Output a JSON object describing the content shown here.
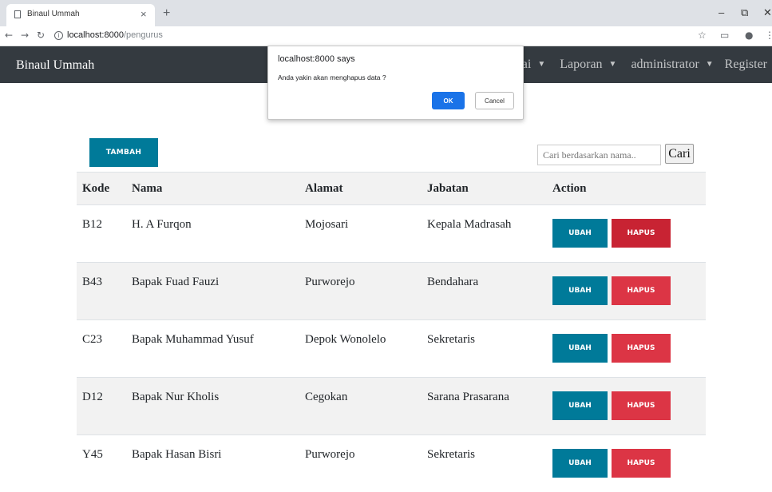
{
  "browser": {
    "tab_title": "Binaul Ummah",
    "tab_close": "×",
    "new_tab": "+",
    "url_host": "localhost:8000",
    "url_path": "/pengurus",
    "window_controls": [
      "–",
      "⧉",
      "✕"
    ]
  },
  "navbar": {
    "brand": "Binaul Ummah",
    "links": [
      "Nilai",
      "Laporan",
      "administrator",
      "Register"
    ]
  },
  "dialog": {
    "title": "localhost:8000 says",
    "message": "Anda yakin akan menghapus data ?",
    "ok_label": "OK",
    "cancel_label": "Cancel"
  },
  "toolbar": {
    "add_label": "TAMBAH",
    "search_placeholder": "Cari berdasarkan nama..",
    "search_button": "Cari"
  },
  "table": {
    "headers": [
      "Kode",
      "Nama",
      "Alamat",
      "Jabatan",
      "Action"
    ],
    "rows": [
      {
        "kode": "B12",
        "nama": "H. A Furqon",
        "alamat": "Mojosari",
        "jabatan": "Kepala Madrasah"
      },
      {
        "kode": "B43",
        "nama": "Bapak Fuad Fauzi",
        "alamat": "Purworejo",
        "jabatan": "Bendahara"
      },
      {
        "kode": "C23",
        "nama": "Bapak Muhammad Yusuf",
        "alamat": "Depok Wonolelo",
        "jabatan": "Sekretaris"
      },
      {
        "kode": "D12",
        "nama": "Bapak Nur Kholis",
        "alamat": "Cegokan",
        "jabatan": "Sarana Prasarana"
      },
      {
        "kode": "Y45",
        "nama": "Bapak Hasan Bisri",
        "alamat": "Purworejo",
        "jabatan": "Sekretaris"
      }
    ],
    "edit_label": "UBAH",
    "delete_label": "HAPUS"
  },
  "colors": {
    "navbar": "#343a40",
    "primary": "#007a99",
    "danger": "#dc3545",
    "dialog_ok": "#1a73e8"
  }
}
